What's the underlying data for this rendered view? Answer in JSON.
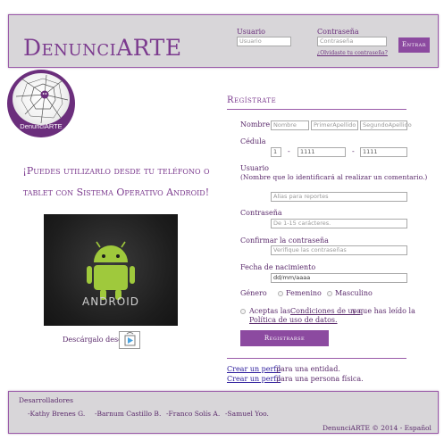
{
  "header": {
    "brand": "DenunciARTE",
    "user_label": "Usuario",
    "user_placeholder": "Usuario",
    "pass_label": "Contraseña",
    "pass_placeholder": "Contraseña",
    "forgot": "¿Olvidaste tu contraseña?",
    "login_button": "Entrar"
  },
  "logo": {
    "text": "DenunciARTE"
  },
  "promo": {
    "line1": "¡Puedes utilizarlo desde tu teléfono o",
    "line2": "tablet con Sistema Operativo Android!",
    "android_text": "ANDROID",
    "download_label": "Descárgalo desde"
  },
  "register": {
    "title": "Regístrate",
    "name_label": "Nombre",
    "name_placeholder": "Nombre",
    "surname1_placeholder": "PrimerApellido",
    "surname2_placeholder": "SegundoApellido",
    "id_label": "Cédula",
    "id_part1": "1",
    "id_part2": "1111",
    "id_part3": "1111",
    "dash": "-",
    "username_label": "Usuario",
    "username_hint": "(Nombre que lo identificará al realizar un comentario.)",
    "username_placeholder": "Alias para reportes",
    "password_label": "Contraseña",
    "password_placeholder": "De 1-15 carácteres.",
    "confirm_label": "Confirmar la contraseña",
    "confirm_placeholder": "Verifique las contraseñas",
    "dob_label": "Fecha de nacimiento",
    "dob_value": "dd/mm/aaaa",
    "gender_label": "Género",
    "gender_female": "Femenino",
    "gender_male": "Masculino",
    "accept_text": "Aceptas las",
    "terms_link": "Condiciones de uso",
    "accept_mid": "y que has leído la",
    "privacy_link": "Política de uso de datos.",
    "submit": "Registrarse",
    "entity_link": "Crear un perfil",
    "entity_text": "para una entidad.",
    "person_link": "Crear un perfil",
    "person_text": "para una persona física."
  },
  "footer": {
    "title": "Desarrolladores",
    "dev1": "-Kathy Brenes G.",
    "dev2": "-Barnum Castillo B.",
    "dev3": "-Franco Solís A.",
    "dev4": "-Samuel Yoo.",
    "copyright": "DenunciARTE © 2014 - Español"
  },
  "colors": {
    "accent": "#8c4aa0",
    "brand": "#7b3a8e",
    "panel": "#d8d6d9",
    "link": "#2b1b9c"
  }
}
